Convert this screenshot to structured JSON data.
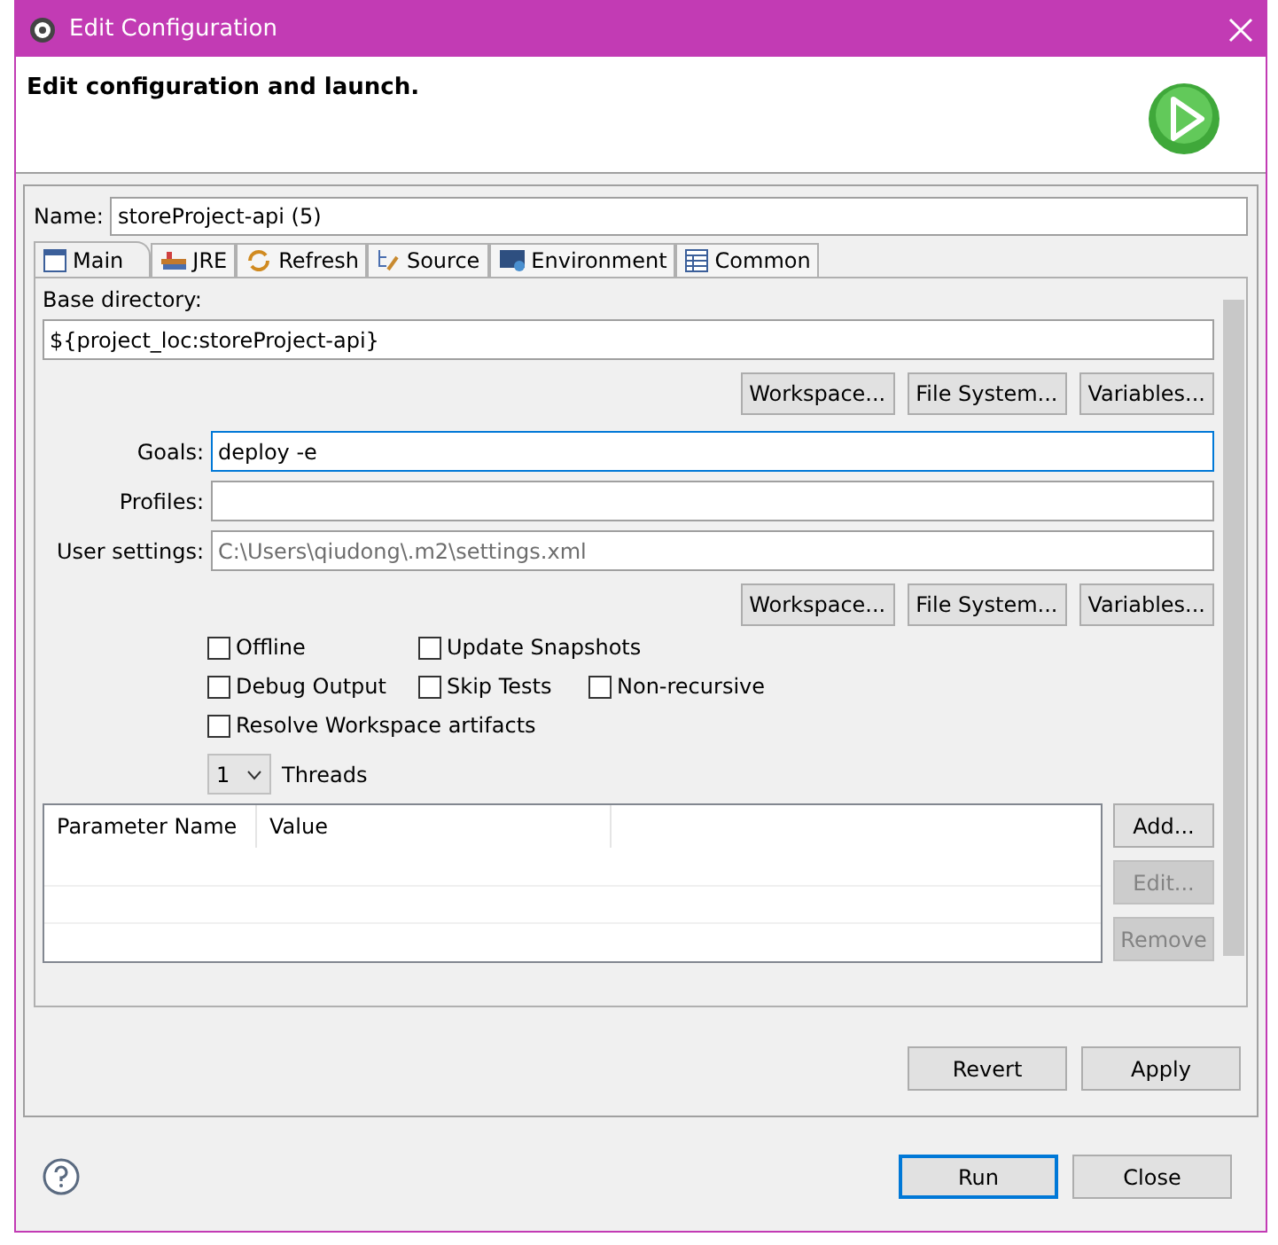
{
  "window": {
    "title": "Edit Configuration"
  },
  "header": {
    "message": "Edit configuration and launch."
  },
  "name_field": {
    "label": "Name:",
    "value": "storeProject-api (5)"
  },
  "tabs": [
    {
      "label": "Main",
      "selected": true,
      "kind": "main"
    },
    {
      "label": "JRE",
      "selected": false,
      "kind": "jre"
    },
    {
      "label": "Refresh",
      "selected": false,
      "kind": "refresh"
    },
    {
      "label": "Source",
      "selected": false,
      "kind": "source"
    },
    {
      "label": "Environment",
      "selected": false,
      "kind": "environment"
    },
    {
      "label": "Common",
      "selected": false,
      "kind": "common"
    }
  ],
  "base_directory": {
    "label": "Base directory:",
    "value": "${project_loc:storeProject-api}",
    "buttons": [
      "Workspace...",
      "File System...",
      "Variables..."
    ]
  },
  "goals": {
    "label": "Goals:",
    "value": "deploy -e",
    "focused": true
  },
  "profiles": {
    "label": "Profiles:"
  },
  "user_settings": {
    "label": "User settings:",
    "value": "C:\\Users\\qiudong\\.m2\\settings.xml",
    "buttons": [
      "Workspace...",
      "File System...",
      "Variables..."
    ]
  },
  "options": [
    [
      {
        "label": "Offline",
        "checked": false
      },
      {
        "label": "Update Snapshots",
        "checked": false
      }
    ],
    [
      {
        "label": "Debug Output",
        "checked": false
      },
      {
        "label": "Skip Tests",
        "checked": false
      },
      {
        "label": "Non-recursive",
        "checked": false
      }
    ],
    [
      {
        "label": "Resolve Workspace artifacts",
        "checked": false
      }
    ]
  ],
  "threads": {
    "value": "1",
    "label": "Threads"
  },
  "parameters": {
    "columns": [
      "Parameter Name",
      "Value"
    ],
    "buttons": [
      {
        "label": "Add...",
        "disabled": false
      },
      {
        "label": "Edit...",
        "disabled": true
      },
      {
        "label": "Remove",
        "disabled": true
      }
    ]
  },
  "panel_buttons": [
    "Revert",
    "Apply"
  ],
  "footer_buttons": [
    {
      "label": "Run",
      "default": true
    },
    {
      "label": "Close",
      "default": false
    }
  ]
}
